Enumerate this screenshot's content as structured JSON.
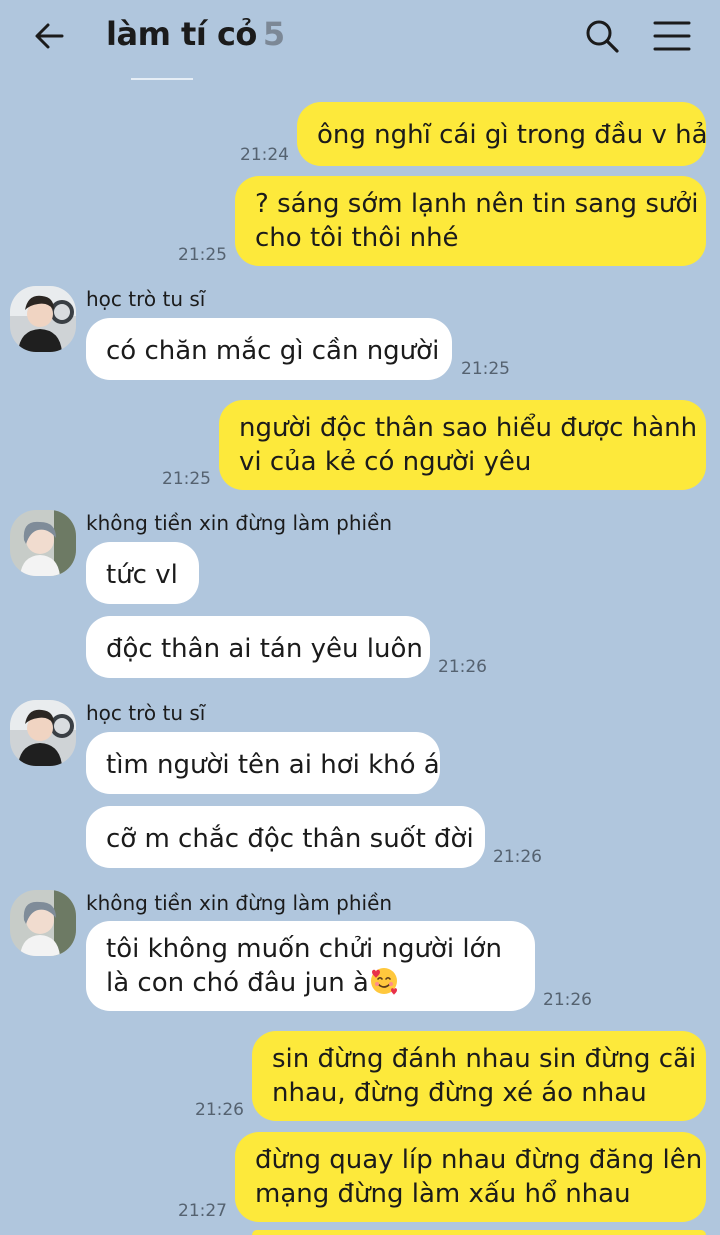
{
  "header": {
    "title": "làm tí cỏ",
    "member_count": "5"
  },
  "messages": [
    {
      "from": "me",
      "lines": [
        "ông nghĩ cái gì trong đầu v hả"
      ],
      "time": "21:24"
    },
    {
      "from": "me",
      "lines": [
        "? sáng sớm lạnh nên tin sang sưởi",
        "cho tôi thôi nhé"
      ],
      "time": "21:25"
    },
    {
      "from": "hoc_tro",
      "sender": "học trò tu sĩ",
      "lines": [
        "có chăn mắc gì cần người"
      ],
      "time": "21:25"
    },
    {
      "from": "me",
      "lines": [
        "người độc thân sao hiểu được hành",
        "vi của kẻ có người yêu"
      ],
      "time": "21:25"
    },
    {
      "from": "khong_tien",
      "sender": "không tiền xin đừng làm phiền",
      "lines": [
        "tức vl"
      ]
    },
    {
      "from": "khong_tien",
      "lines": [
        "độc thân ai tán yêu luôn"
      ],
      "time": "21:26"
    },
    {
      "from": "hoc_tro",
      "sender": "học trò tu sĩ",
      "lines": [
        "tìm người tên ai hơi khó á"
      ]
    },
    {
      "from": "hoc_tro",
      "lines": [
        "cỡ m chắc độc thân suốt đời"
      ],
      "time": "21:26"
    },
    {
      "from": "khong_tien",
      "sender": "không tiền xin đừng làm phiền",
      "lines": [
        "tôi không muốn chửi người lớn",
        "là con chó đâu jun à"
      ],
      "emoji": "smiling-face-with-hearts",
      "time": "21:26"
    },
    {
      "from": "me",
      "lines": [
        "sin đừng đánh nhau sin đừng cãi",
        "nhau, đừng đừng xé áo nhau"
      ],
      "time": "21:26"
    },
    {
      "from": "me",
      "lines": [
        "đừng quay líp nhau đừng đăng lên",
        "mạng đừng làm xấu hổ nhau"
      ],
      "time": "21:27"
    }
  ],
  "colors": {
    "background": "#b0c6dd",
    "my_bubble": "#fde93b",
    "their_bubble": "#ffffff",
    "time_text": "#556270"
  },
  "icons": [
    "back-arrow-icon",
    "search-icon",
    "menu-icon"
  ]
}
